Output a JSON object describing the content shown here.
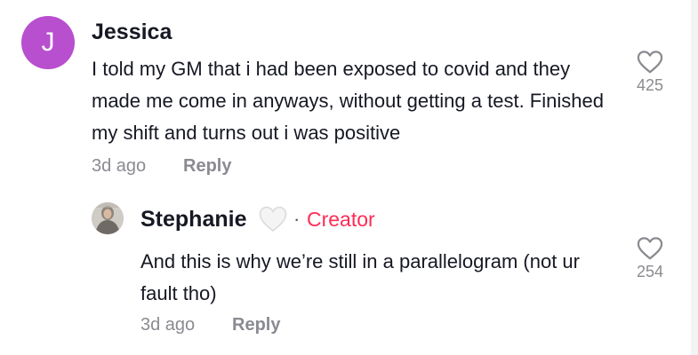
{
  "comments": [
    {
      "avatar_letter": "J",
      "avatar_color": "#b84fcf",
      "username": "Jessica",
      "text": "I told my GM that i had been exposed to covid and they made me come in anyways, without getting a test. Finished my shift and turns out i was positive",
      "time": "3d ago",
      "reply_label": "Reply",
      "likes": "425",
      "like_icon": "heart-outline-icon"
    },
    {
      "username": "Stephanie",
      "badge_emoji": "white-heart-icon",
      "creator_label": "Creator",
      "creator_color": "#fe2c55",
      "text": "And this is why we’re still in a parallelogram (not ur fault tho)",
      "time": "3d ago",
      "reply_label": "Reply",
      "likes": "254",
      "like_icon": "heart-outline-icon"
    }
  ]
}
